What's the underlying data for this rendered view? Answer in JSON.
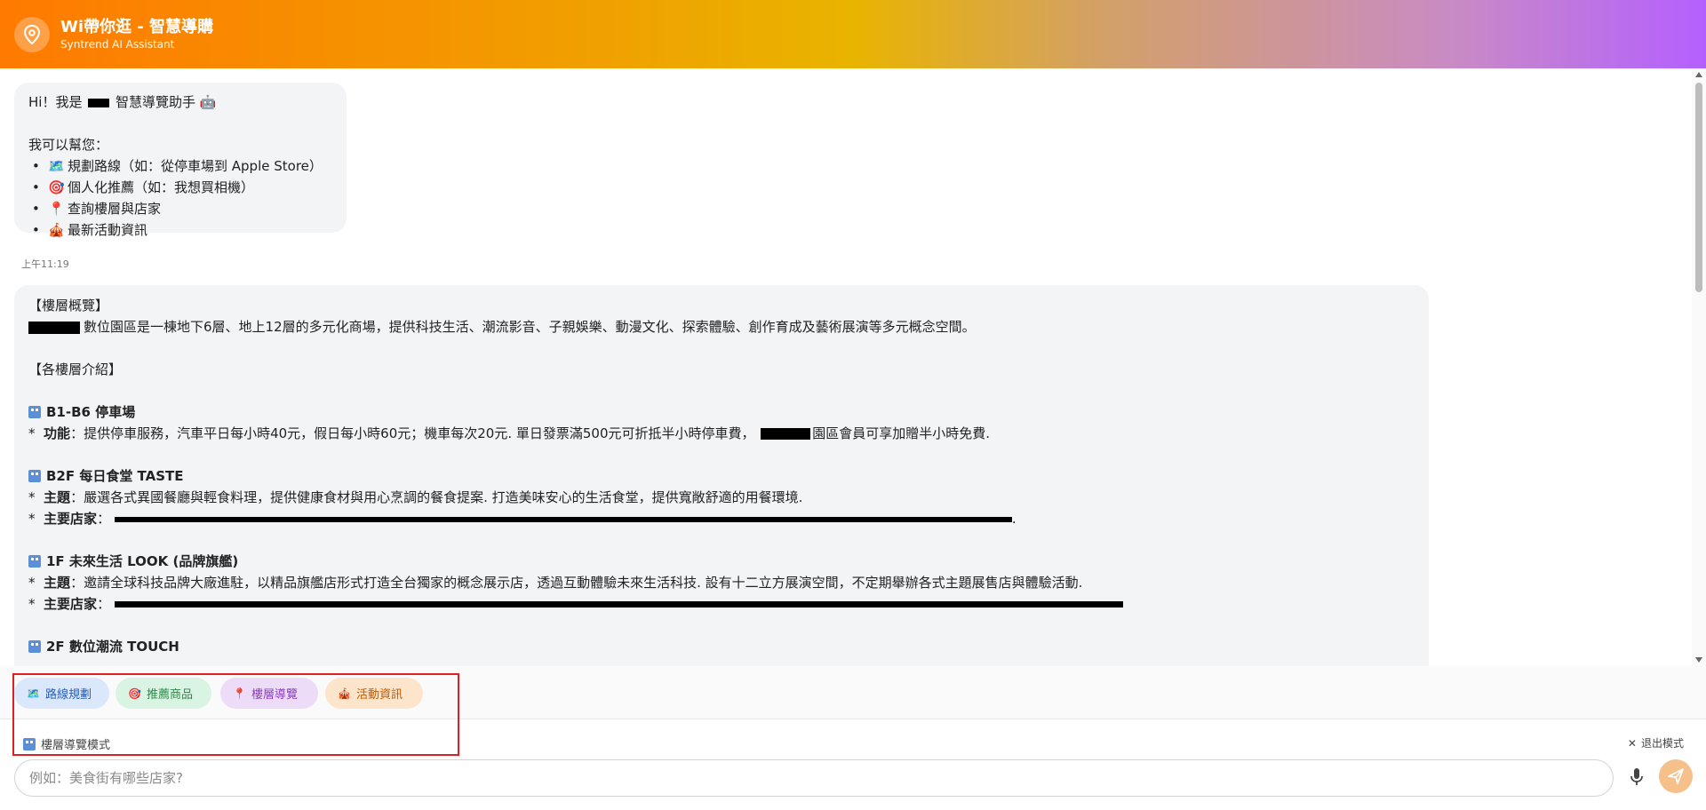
{
  "header": {
    "title": "Wi帶你逛 - 智慧導購",
    "subtitle": "Syntrend AI Assistant",
    "icon": "location-pin-icon"
  },
  "welcome": {
    "greeting_prefix": "Hi！我是",
    "greeting_suffix": "智慧導覽助手 🤖",
    "intro": "我可以幫您：",
    "items": [
      {
        "bullet": "•",
        "emoji": "🗺️",
        "text": "規劃路線（如：從停車場到 Apple Store）"
      },
      {
        "bullet": "•",
        "emoji": "🎯",
        "text": "個人化推薦（如：我想買相機）"
      },
      {
        "bullet": "•",
        "emoji": "📍",
        "text": "查詢樓層與店家"
      },
      {
        "bullet": "•",
        "emoji": "🎪",
        "text": "最新活動資訊"
      }
    ],
    "time": "上午11:19"
  },
  "floor_msg": {
    "overview_heading": "【樓層概覽】",
    "overview_text": "數位園區是一棟地下6層、地上12層的多元化商場，提供科技生活、潮流影音、子親娛樂、動漫文化、探索體驗、創作育成及藝術展演等多元概念空間。",
    "intro_heading": "【各樓層介紹】",
    "sections": [
      {
        "title": "B1-B6 停車場",
        "lines": [
          {
            "bullet": "*",
            "label": "功能",
            "text": "：提供停車服務，汽車平日每小時40元，假日每小時60元；機車每次20元. 單日發票滿500元可折抵半小時停車費，",
            "after": "園區會員可享加贈半小時免費."
          }
        ]
      },
      {
        "title": "B2F 每日食堂 TASTE",
        "lines": [
          {
            "bullet": "*",
            "label": "主題",
            "text": "：嚴選各式異國餐廳與輕食料理，提供健康食材與用心烹調的餐食提案. 打造美味安心的生活食堂，提供寬敞舒適的用餐環境."
          },
          {
            "bullet": "*",
            "label": "主要店家",
            "text": "：",
            "after": "."
          }
        ]
      },
      {
        "title": "1F 未來生活 LOOK (品牌旗艦)",
        "lines": [
          {
            "bullet": "*",
            "label": "主題",
            "text": "：邀請全球科技品牌大廠進駐，以精品旗艦店形式打造全台獨家的概念展示店，透過互動體驗未來生活科技. 設有十二立方展演空間，不定期舉辦各式主題展售店與體驗活動."
          },
          {
            "bullet": "*",
            "label": "主要店家",
            "text": "："
          }
        ]
      },
      {
        "title": "2F 數位潮流 TOUCH",
        "lines": []
      }
    ]
  },
  "chips": [
    {
      "icon": "🗺️",
      "label": "路線規劃"
    },
    {
      "icon": "🎯",
      "label": "推薦商品"
    },
    {
      "icon": "📍",
      "label": "樓層導覽"
    },
    {
      "icon": "🎪",
      "label": "活動資訊"
    }
  ],
  "mode": {
    "label": "樓層導覽模式",
    "exit_label": "退出模式"
  },
  "input": {
    "placeholder": "例如：美食街有哪些店家?",
    "value": ""
  },
  "colors": {
    "header_start": "#ff7a00",
    "header_end": "#b460ff",
    "send_button": "#f5c08a",
    "highlight_box": "#e02020"
  }
}
